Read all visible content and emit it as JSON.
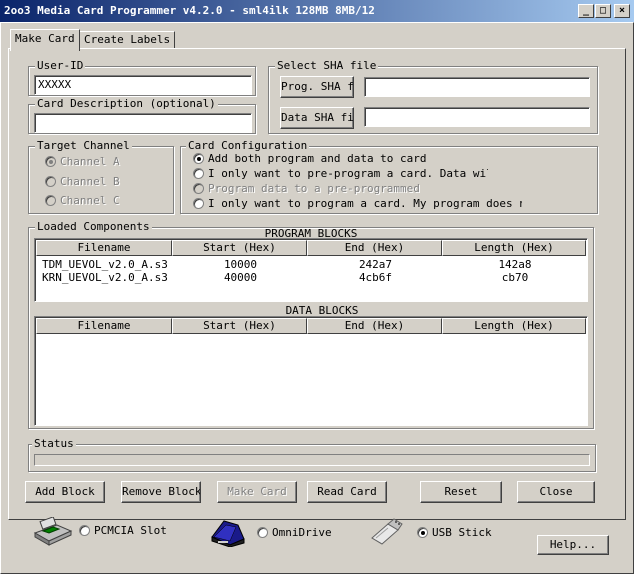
{
  "window": {
    "title": "2oo3 Media Card Programmer v4.2.0 - sml4ilk 128MB 8MB/12",
    "minimize": "_",
    "maximize": "□",
    "close": "×"
  },
  "tabs": [
    {
      "label": "Make Card",
      "active": true
    },
    {
      "label": "Create Labels",
      "active": false
    }
  ],
  "user_id": {
    "label": "User-ID",
    "value": "XXXXX"
  },
  "card_description": {
    "label": "Card Description (optional)",
    "value": ""
  },
  "sha": {
    "label": "Select SHA file",
    "prog_button": "Prog. SHA fil",
    "prog_value": "",
    "data_button": "Data SHA fil",
    "data_value": ""
  },
  "target_channel": {
    "label": "Target Channel",
    "options": [
      {
        "label": "Channel A",
        "checked": true
      },
      {
        "label": "Channel B",
        "checked": false
      },
      {
        "label": "Channel C",
        "checked": false
      }
    ]
  },
  "card_config": {
    "label": "Card Configuration",
    "options": [
      {
        "label": "Add both program and data to card",
        "checked": true,
        "disabled": false
      },
      {
        "label": "I only want to pre-program a card. Data will be",
        "checked": false,
        "disabled": false
      },
      {
        "label": "Program data to a pre-programmed",
        "checked": false,
        "disabled": true
      },
      {
        "label": "I only want to program a card. My program does not u",
        "checked": false,
        "disabled": false
      }
    ]
  },
  "loaded_components": {
    "label": "Loaded Components",
    "program_title": "PROGRAM BLOCKS",
    "data_title": "DATA BLOCKS",
    "columns": [
      "Filename",
      "Start (Hex)",
      "End (Hex)",
      "Length (Hex)"
    ],
    "program_rows": [
      [
        "TDM_UEVOL_v2.0_A.s3",
        "10000",
        "242a7",
        "142a8"
      ],
      [
        "KRN_UEVOL_v2.0_A.s3",
        "40000",
        "4cb6f",
        "cb70"
      ]
    ],
    "data_rows": []
  },
  "status": {
    "label": "Status",
    "progress": 0
  },
  "buttons": {
    "add_block": "Add Block",
    "remove_block": "Remove Block",
    "make_card": "Make Card",
    "read_card": "Read Card",
    "reset": "Reset",
    "close": "Close",
    "help": "Help..."
  },
  "devices": [
    {
      "label": "PCMCIA Slot",
      "icon": "pcmcia-drive-icon",
      "checked": false
    },
    {
      "label": "OmniDrive",
      "icon": "omnidrive-icon",
      "checked": false
    },
    {
      "label": "USB Stick",
      "icon": "usb-stick-icon",
      "checked": true
    }
  ]
}
